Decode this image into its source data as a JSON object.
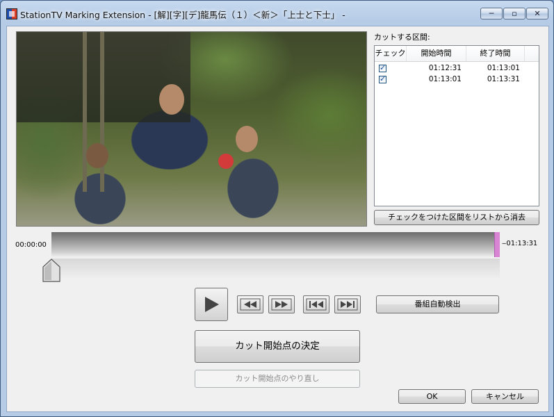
{
  "window": {
    "title": "StationTV Marking Extension - [解][字][デ]龍馬伝（１）＜新＞「上士と下士」 -",
    "minimize_glyph": "─",
    "maximize_glyph": "▫",
    "close_glyph": "✕"
  },
  "cut_list": {
    "label": "カットする区間:",
    "columns": [
      "チェック",
      "開始時間",
      "終了時間"
    ],
    "rows": [
      {
        "checked": true,
        "start": "01:12:31",
        "end": "01:13:01"
      },
      {
        "checked": true,
        "start": "01:13:01",
        "end": "01:13:31"
      }
    ],
    "check_glyph": "✓",
    "remove_checked_label": "チェックをつけた区間をリストから消去"
  },
  "timeline": {
    "start_time": "00:00:00",
    "end_time": "01:13:31",
    "position_fraction": 0.0
  },
  "controls": {
    "auto_detect_label": "番組自動検出",
    "cut_start_label": "カット開始点の決定",
    "redo_cut_start_label": "カット開始点のやり直し",
    "ok_label": "OK",
    "cancel_label": "キャンセル"
  }
}
